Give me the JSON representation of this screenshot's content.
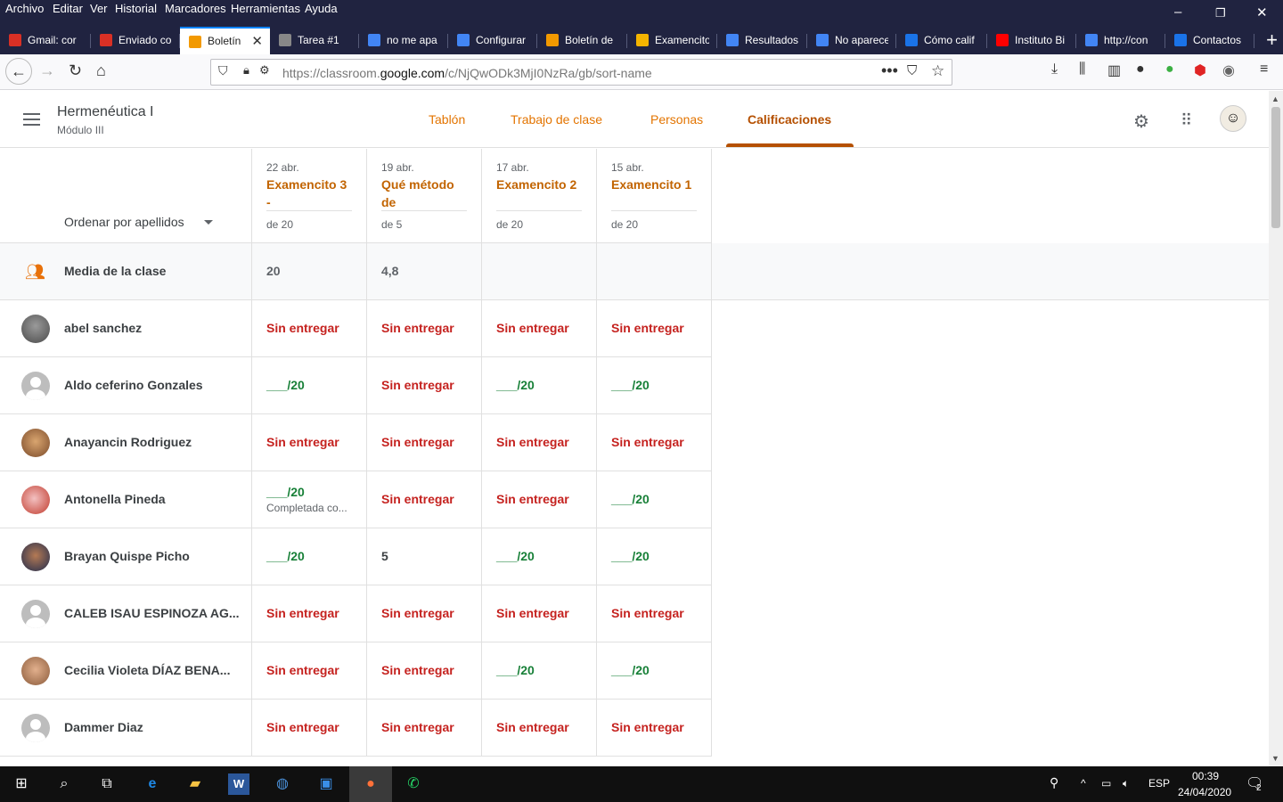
{
  "menubar": {
    "items": [
      "Archivo",
      "Editar",
      "Ver",
      "Historial",
      "Marcadores",
      "Herramientas",
      "Ayuda"
    ]
  },
  "tabs": [
    {
      "label": "Gmail: cor",
      "color": "#d93025"
    },
    {
      "label": "Enviado co",
      "color": "#d93025"
    },
    {
      "label": "Boletín",
      "color": "#f29900",
      "active": true
    },
    {
      "label": "Tarea #1",
      "color": "#888888"
    },
    {
      "label": "no me apa",
      "color": "#4285f4"
    },
    {
      "label": "Configurar",
      "color": "#4285f4"
    },
    {
      "label": "Boletín de",
      "color": "#f29900"
    },
    {
      "label": "Examencito",
      "color": "#f4b400"
    },
    {
      "label": "Resultados",
      "color": "#4285f4"
    },
    {
      "label": "No aparece",
      "color": "#4285f4"
    },
    {
      "label": "Cómo calif",
      "color": "#1a73e8"
    },
    {
      "label": "Instituto Bi",
      "color": "#ff0000"
    },
    {
      "label": "http://con",
      "color": "#4285f4"
    },
    {
      "label": "Contactos",
      "color": "#1a73e8"
    }
  ],
  "url": {
    "prefix": "https://classroom.",
    "domain": "google.com",
    "path": "/c/NjQwODk3MjI0NzRa/gb/sort-name"
  },
  "course": {
    "title": "Hermenéutica I",
    "subtitle": "Módulo III"
  },
  "nav": {
    "tabs": [
      "Tablón",
      "Trabajo de clase",
      "Personas",
      "Calificaciones"
    ],
    "active": "Calificaciones"
  },
  "sort_label": "Ordenar por apellidos",
  "assignments": [
    {
      "date": "22 abr.",
      "title": "Examencito 3 -",
      "points": "de 20"
    },
    {
      "date": "19 abr.",
      "title": "Qué método de",
      "points": "de 5"
    },
    {
      "date": "17 abr.",
      "title": "Examencito 2",
      "points": "de 20"
    },
    {
      "date": "15 abr.",
      "title": "Examencito 1",
      "points": "de 20"
    }
  ],
  "class_average": {
    "label": "Media de la clase",
    "values": [
      "20",
      "4,8",
      "",
      ""
    ]
  },
  "students": [
    {
      "name": "abel sanchez",
      "grades": [
        "Sin entregar",
        "Sin entregar",
        "Sin entregar",
        "Sin entregar"
      ]
    },
    {
      "name": "Aldo ceferino Gonzales",
      "grades": [
        "___/20",
        "Sin entregar",
        "___/20",
        "___/20"
      ]
    },
    {
      "name": "Anayancin Rodriguez",
      "grades": [
        "Sin entregar",
        "Sin entregar",
        "Sin entregar",
        "Sin entregar"
      ]
    },
    {
      "name": "Antonella Pineda",
      "grades": [
        "___/20",
        "Sin entregar",
        "Sin entregar",
        "___/20"
      ],
      "note": "Completada co..."
    },
    {
      "name": "Brayan Quispe Picho",
      "grades": [
        "___/20",
        "5",
        "___/20",
        "___/20"
      ]
    },
    {
      "name": "CALEB ISAU ESPINOZA AG...",
      "grades": [
        "Sin entregar",
        "Sin entregar",
        "Sin entregar",
        "Sin entregar"
      ]
    },
    {
      "name": "Cecilia Violeta DÍAZ BENA...",
      "grades": [
        "Sin entregar",
        "Sin entregar",
        "___/20",
        "___/20"
      ]
    },
    {
      "name": "Dammer Diaz",
      "grades": [
        "Sin entregar",
        "Sin entregar",
        "Sin entregar",
        "Sin entregar"
      ]
    }
  ],
  "taskbar": {
    "lang": "ESP",
    "time": "00:39",
    "date": "24/04/2020",
    "notifications": "2"
  }
}
